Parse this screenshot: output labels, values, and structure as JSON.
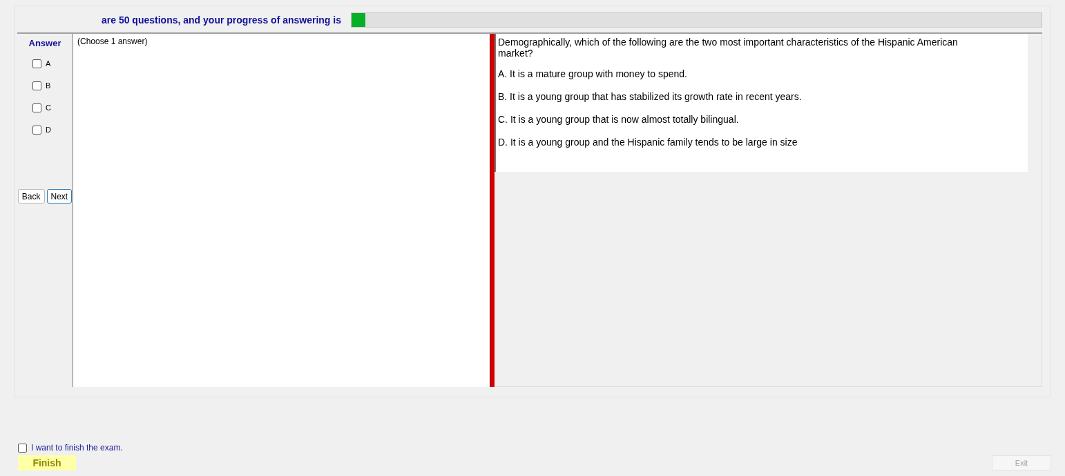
{
  "header": {
    "text": "are 50 questions, and your progress of answering is",
    "progress": {
      "level": 0.02
    }
  },
  "answer_panel": {
    "title": "Answer",
    "options": [
      {
        "label": "A",
        "checked": false
      },
      {
        "label": "B",
        "checked": false
      },
      {
        "label": "C",
        "checked": false
      },
      {
        "label": "D",
        "checked": false
      }
    ],
    "buttons": [
      {
        "label": "Back",
        "focused": false
      },
      {
        "label": "Next",
        "focused": true
      }
    ]
  },
  "instruction": "(Choose 1 answer)",
  "question": {
    "text": "Demographically, which of the following are the two most important characteristics of the Hispanic American market?",
    "choices": [
      "A.  It is a mature group with money to spend.",
      "B.  It is a young group that has stabilized its growth rate in recent years.",
      "C.  It is a young group that is now almost totally bilingual.",
      "D.  It is a young group and the Hispanic family tends to be large in size"
    ]
  },
  "finish_confirm": {
    "label": "I want to finish the exam.",
    "checked": false
  },
  "finish_button": {
    "label": "Finish"
  },
  "exit_button": {
    "label": "Exit",
    "disabled": true
  }
}
